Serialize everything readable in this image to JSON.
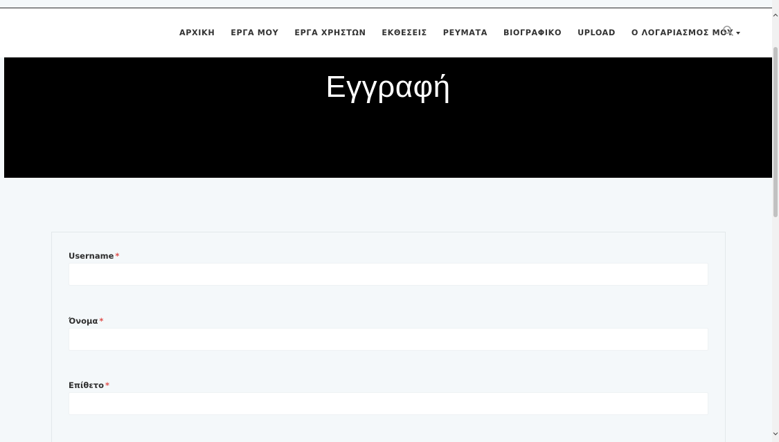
{
  "nav": {
    "items": [
      {
        "label": "ΑΡΧΙΚΗ"
      },
      {
        "label": "ΕΡΓΑ ΜΟΥ"
      },
      {
        "label": "ΕΡΓΑ ΧΡΗΣΤΩΝ"
      },
      {
        "label": "ΕΚΘΕΣΕΙΣ"
      },
      {
        "label": "ΡΕΥΜΑΤΑ"
      },
      {
        "label": "ΒΙΟΓΡΑΦΙΚΟ"
      },
      {
        "label": "UPLOAD"
      },
      {
        "label": "Ο ΛΟΓΑΡΙΑΣΜΟΣ ΜΟΥ",
        "has_dropdown": true
      }
    ],
    "search_icon": "search-icon"
  },
  "hero": {
    "title": "Εγγραφή"
  },
  "form": {
    "required_marker": "*",
    "fields": [
      {
        "label": "Username",
        "value": ""
      },
      {
        "label": "Όνομα",
        "value": ""
      },
      {
        "label": "Επίθετο",
        "value": ""
      }
    ]
  },
  "colors": {
    "hero_bg": "#000000",
    "page_bg": "#f4f8fa",
    "required": "#e0504d",
    "nav_text": "#333333"
  }
}
